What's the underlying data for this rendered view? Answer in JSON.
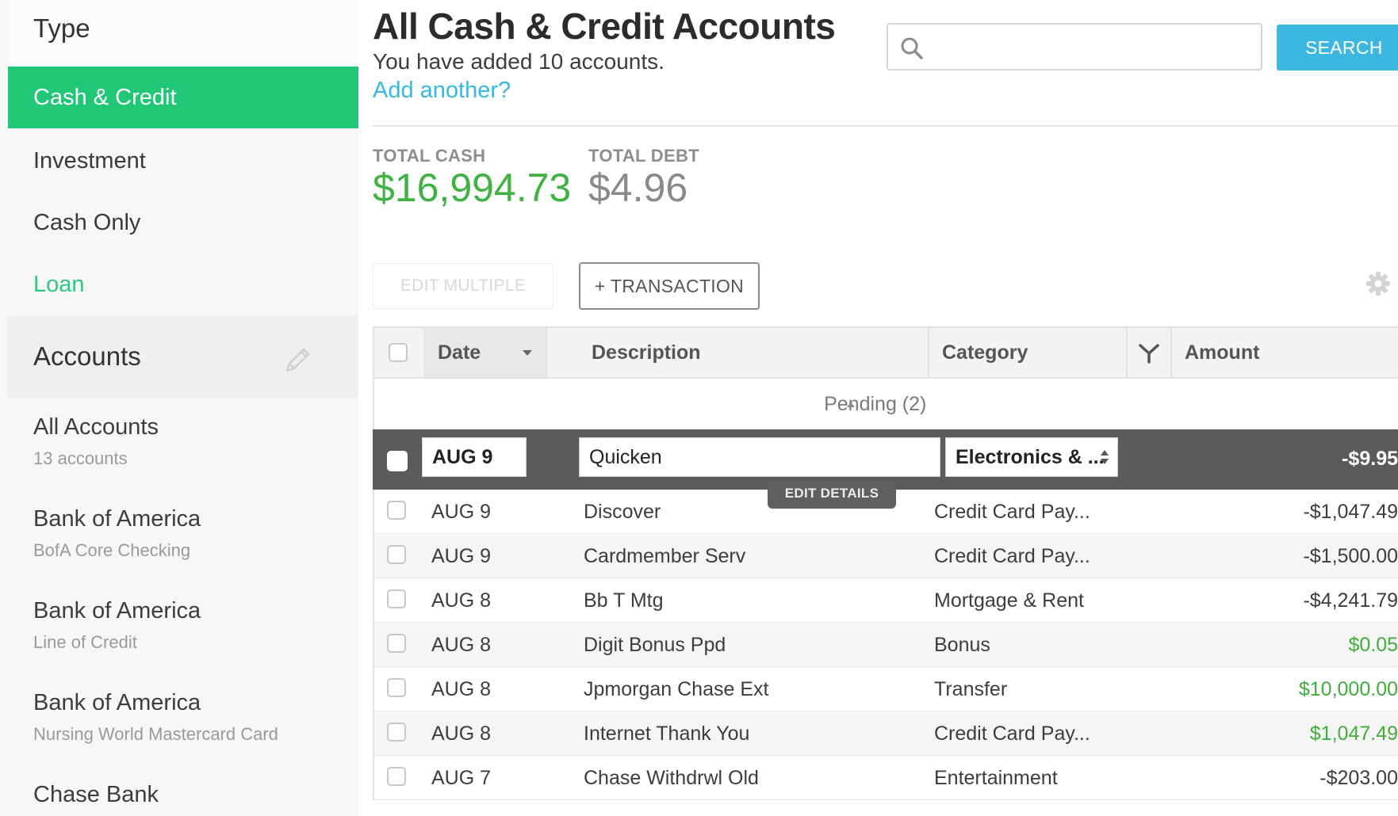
{
  "sidebar": {
    "type_header": "Type",
    "types": [
      {
        "label": "Cash & Credit"
      },
      {
        "label": "Investment"
      },
      {
        "label": "Cash Only"
      },
      {
        "label": "Loan"
      }
    ],
    "accounts_header": "Accounts",
    "accounts": [
      {
        "name": "All Accounts",
        "sub": "13 accounts"
      },
      {
        "name": "Bank of America",
        "sub": "BofA Core Checking"
      },
      {
        "name": "Bank of America",
        "sub": "Line of Credit"
      },
      {
        "name": "Bank of America",
        "sub": "Nursing World Mastercard Card"
      },
      {
        "name": "Chase Bank",
        "sub": ""
      }
    ]
  },
  "header": {
    "title": "All Cash & Credit Accounts",
    "added_text": "You have added 10 accounts.",
    "add_link": "Add another?",
    "search_placeholder": "",
    "search_button": "SEARCH"
  },
  "totals": {
    "cash_label": "TOTAL CASH",
    "cash_value": "$16,994.73",
    "debt_label": "TOTAL DEBT",
    "debt_value": "$4.96"
  },
  "toolbar": {
    "edit_multiple": "EDIT MULTIPLE",
    "add_transaction": "+ TRANSACTION"
  },
  "table": {
    "columns": {
      "date": "Date",
      "description": "Description",
      "category": "Category",
      "amount": "Amount"
    },
    "pending_label": "Pending (2)",
    "selected_row": {
      "date": "AUG 9",
      "description": "Quicken",
      "category": "Electronics & ...",
      "amount": "-$9.95"
    },
    "edit_details": "EDIT DETAILS",
    "rows": [
      {
        "date": "AUG 9",
        "description": "Discover",
        "category": "Credit Card Pay...",
        "amount": "-$1,047.49",
        "positive": false
      },
      {
        "date": "AUG 9",
        "description": "Cardmember Serv",
        "category": "Credit Card Pay...",
        "amount": "-$1,500.00",
        "positive": false
      },
      {
        "date": "AUG 8",
        "description": "Bb T Mtg",
        "category": "Mortgage & Rent",
        "amount": "-$4,241.79",
        "positive": false
      },
      {
        "date": "AUG 8",
        "description": "Digit Bonus Ppd",
        "category": "Bonus",
        "amount": "$0.05",
        "positive": true
      },
      {
        "date": "AUG 8",
        "description": "Jpmorgan Chase Ext",
        "category": "Transfer",
        "amount": "$10,000.00",
        "positive": true
      },
      {
        "date": "AUG 8",
        "description": "Internet Thank You",
        "category": "Credit Card Pay...",
        "amount": "$1,047.49",
        "positive": true
      },
      {
        "date": "AUG 7",
        "description": "Chase Withdrwl Old",
        "category": "Entertainment",
        "amount": "-$203.00",
        "positive": false
      }
    ]
  },
  "colors": {
    "accent_green": "#1fc777",
    "link_blue": "#35b8e4",
    "positive_amount": "#3fae3a",
    "selected_row": "#5a5a5a"
  },
  "icons": [
    "search-icon",
    "pencil-icon",
    "gear-icon",
    "sort-down-icon",
    "filter-icon",
    "pending-up-icon",
    "select-arrows-icon"
  ]
}
